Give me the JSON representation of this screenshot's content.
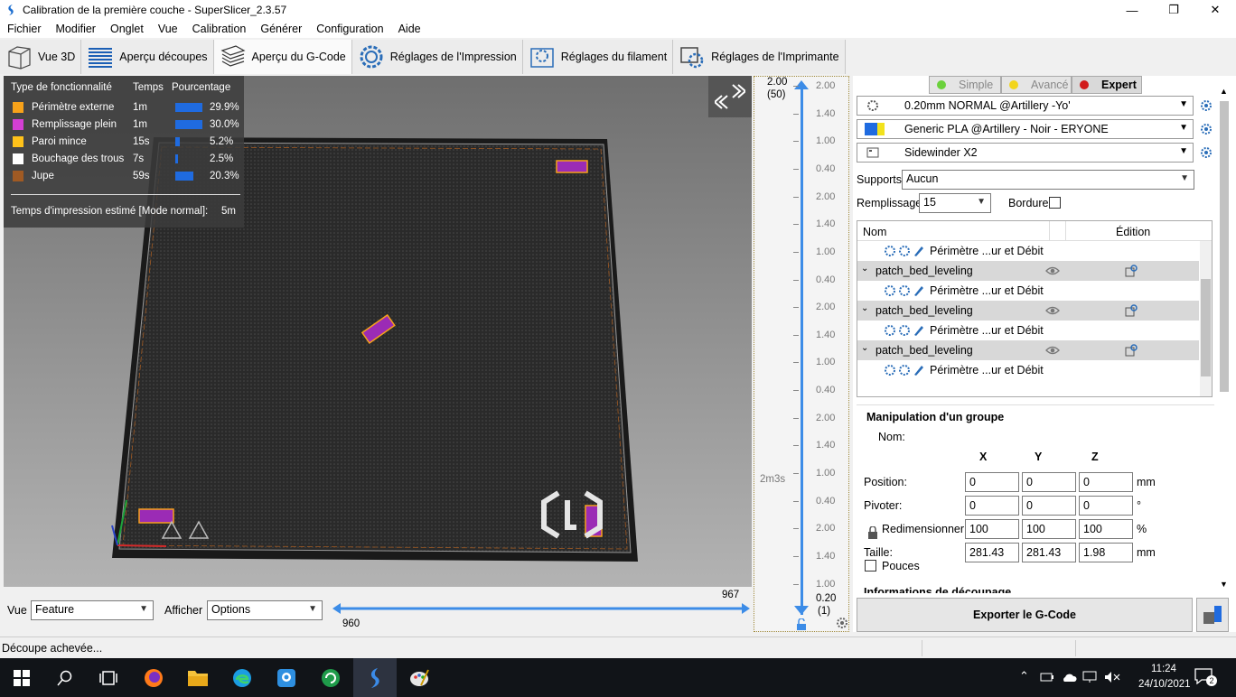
{
  "window": {
    "title": "Calibration de la première couche - SuperSlicer_2.3.57"
  },
  "menu": [
    "Fichier",
    "Modifier",
    "Onglet",
    "Vue",
    "Calibration",
    "Générer",
    "Configuration",
    "Aide"
  ],
  "tabs": [
    {
      "label": "Vue 3D",
      "icon": "cube-icon"
    },
    {
      "label": "Aperçu découpes",
      "icon": "layers-icon"
    },
    {
      "label": "Aperçu du G-Code",
      "icon": "gcode-layers-icon",
      "active": true
    },
    {
      "label": "Réglages de l'Impression",
      "icon": "print-settings-gear-icon"
    },
    {
      "label": "Réglages du filament",
      "icon": "filament-settings-icon"
    },
    {
      "label": "Réglages de l'Imprimante",
      "icon": "printer-settings-icon"
    }
  ],
  "legend": {
    "headers": {
      "type": "Type de fonctionnalité",
      "time": "Temps",
      "percent": "Pourcentage"
    },
    "rows": [
      {
        "name": "Périmètre externe",
        "time": "1m",
        "percent": "29.9%",
        "fraction": 0.299,
        "color": "#f7a21a"
      },
      {
        "name": "Remplissage plein",
        "time": "1m",
        "percent": "30.0%",
        "fraction": 0.3,
        "color": "#d43fd4"
      },
      {
        "name": "Paroi mince",
        "time": "15s",
        "percent": "5.2%",
        "fraction": 0.052,
        "color": "#ffc21a"
      },
      {
        "name": "Bouchage des trous",
        "time": "7s",
        "percent": "2.5%",
        "fraction": 0.025,
        "color": "#ffffff"
      },
      {
        "name": "Jupe",
        "time": "59s",
        "percent": "20.3%",
        "fraction": 0.203,
        "color": "#a05a23"
      }
    ],
    "estimate_label": "Temps d'impression estimé [Mode normal]:",
    "estimate_value": "5m"
  },
  "view_controls": {
    "view_label": "Vue",
    "view_value": "Feature",
    "show_label": "Afficher",
    "show_value": "Options",
    "move_min": "960",
    "move_max": "967"
  },
  "layer_slider": {
    "top_value": "2.00",
    "top_layer": "(50)",
    "bottom_value": "0.20",
    "bottom_layer": "(1)",
    "side_time": "2m3s",
    "ticks": [
      "2.00",
      "1.40",
      "1.00",
      "0.40",
      "2.00",
      "1.40",
      "1.00",
      "0.40",
      "2.00",
      "1.40",
      "1.00",
      "0.40",
      "2.00",
      "1.40",
      "1.00",
      "0.40",
      "2.00",
      "1.40",
      "1.00"
    ]
  },
  "modes": {
    "simple": "Simple",
    "advanced": "Avancé",
    "expert": "Expert"
  },
  "presets": {
    "print": "0.20mm NORMAL @Artillery -Yo'",
    "filament": "Generic PLA @Artillery - Noir - ERYONE",
    "printer": "Sidewinder X2"
  },
  "quick_settings": {
    "supports_label": "Supports:",
    "supports_value": "Aucun",
    "infill_label": "Remplissage:",
    "infill_value": "15",
    "brim_label": "Bordure:"
  },
  "objects": {
    "col_name": "Nom",
    "col_edit": "Édition",
    "rows": [
      {
        "type": "child",
        "label": "Périmètre ...ur et Débit"
      },
      {
        "type": "group",
        "label": "patch_bed_leveling"
      },
      {
        "type": "child",
        "label": "Périmètre ...ur et Débit"
      },
      {
        "type": "group",
        "label": "patch_bed_leveling"
      },
      {
        "type": "child",
        "label": "Périmètre ...ur et Débit"
      },
      {
        "type": "group",
        "label": "patch_bed_leveling"
      },
      {
        "type": "child",
        "label": "Périmètre ...ur et Débit"
      }
    ]
  },
  "manipulation": {
    "title": "Manipulation d'un groupe",
    "name_label": "Nom:",
    "axes": [
      "X",
      "Y",
      "Z"
    ],
    "rows": [
      {
        "label": "Position:",
        "values": [
          "0",
          "0",
          "0"
        ],
        "unit": "mm"
      },
      {
        "label": "Pivoter:",
        "values": [
          "0",
          "0",
          "0"
        ],
        "unit": "°"
      },
      {
        "label": "Redimensionner:",
        "values": [
          "100",
          "100",
          "100"
        ],
        "unit": "%"
      },
      {
        "label": "Taille:",
        "values": [
          "281.43",
          "281.43",
          "1.98"
        ],
        "unit": "mm"
      }
    ],
    "inches_label": "Pouces",
    "next_section": "Informations de découpage"
  },
  "export": {
    "label": "Exporter le G-Code"
  },
  "status": {
    "text": "Découpe achevée..."
  },
  "taskbar": {
    "time": "11:24",
    "date": "24/10/2021",
    "notification_count": "2"
  }
}
